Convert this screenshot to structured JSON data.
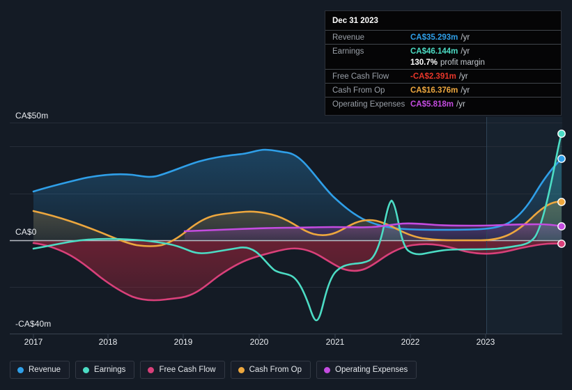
{
  "tooltip": {
    "date": "Dec 31 2023",
    "rows": [
      {
        "label": "Revenue",
        "value": "CA$35.293m",
        "suffix": "/yr",
        "color": "#2f9fe8"
      },
      {
        "label": "Earnings",
        "value": "CA$46.144m",
        "suffix": "/yr",
        "color": "#4cdcc4"
      },
      {
        "label": "",
        "value": "130.7%",
        "suffix": "profit margin",
        "color": "#ffffff"
      },
      {
        "label": "Free Cash Flow",
        "value": "-CA$2.391m",
        "suffix": "/yr",
        "color": "#e8362a"
      },
      {
        "label": "Cash From Op",
        "value": "CA$16.376m",
        "suffix": "/yr",
        "color": "#eda73e"
      },
      {
        "label": "Operating Expenses",
        "value": "CA$5.818m",
        "suffix": "/yr",
        "color": "#c44ce0"
      }
    ]
  },
  "axes": {
    "y_top": "CA$50m",
    "y_zero": "CA$0",
    "y_bottom": "-CA$40m",
    "x_labels": [
      "2017",
      "2018",
      "2019",
      "2020",
      "2021",
      "2022",
      "2023"
    ]
  },
  "legend": [
    {
      "label": "Revenue",
      "color": "#2f9fe8"
    },
    {
      "label": "Earnings",
      "color": "#4cdcc4"
    },
    {
      "label": "Free Cash Flow",
      "color": "#d9407a"
    },
    {
      "label": "Cash From Op",
      "color": "#eda73e"
    },
    {
      "label": "Operating Expenses",
      "color": "#c44ce0"
    }
  ],
  "chart_data": {
    "type": "area",
    "title": "",
    "xlabel": "",
    "ylabel": "CA$",
    "ylim": [
      -40,
      50
    ],
    "xlim": [
      2016.75,
      2024.0
    ],
    "grid": true,
    "legend_position": "bottom",
    "currency": "CA$",
    "units": "millions",
    "gridline_values": [
      50,
      42,
      26,
      10,
      -6,
      -22,
      -40
    ],
    "forecast_start": 2022.85,
    "annotation": "Vertical divider at 2022.85 separates historical from forecast period; forecast region has lighter background.",
    "x": [
      2016.85,
      2017.1,
      2017.35,
      2017.6,
      2017.85,
      2018.1,
      2018.35,
      2018.6,
      2018.85,
      2019.1,
      2019.35,
      2019.6,
      2019.85,
      2020.1,
      2020.35,
      2020.6,
      2020.85,
      2021.1,
      2021.35,
      2021.6,
      2021.85,
      2022.1,
      2022.35,
      2022.6,
      2022.85,
      2023.1,
      2023.35,
      2023.6,
      2023.85
    ],
    "series": [
      {
        "name": "Revenue",
        "color": "#2f9fe8",
        "values": [
          16.5,
          18.5,
          20.0,
          21.5,
          22.5,
          22.0,
          23.5,
          25.5,
          27.5,
          29.5,
          33.0,
          35.5,
          36.0,
          35.0,
          31.0,
          27.5,
          25.0,
          23.0,
          21.0,
          19.0,
          17.5,
          17.0,
          17.0,
          17.0,
          17.0,
          18.0,
          22.0,
          30.0,
          35.293
        ],
        "endpoint_value": 35.293
      },
      {
        "name": "Earnings",
        "color": "#4cdcc4",
        "values": [
          -3.5,
          -2.5,
          -1.5,
          -0.8,
          -0.5,
          -1.0,
          -2.0,
          -2.5,
          -2.5,
          -2.5,
          -3.5,
          -6.0,
          -4.5,
          -8.0,
          -12.0,
          -19.0,
          -30.5,
          -19.0,
          -11.5,
          6.5,
          -9.0,
          -7.5,
          -6.0,
          -5.5,
          -7.5,
          -7.5,
          -6.0,
          12.0,
          46.144
        ],
        "endpoint_value": 46.144
      },
      {
        "name": "Free Cash Flow",
        "color": "#d9407a",
        "values": [
          -1.5,
          -2.0,
          -3.0,
          -5.5,
          -9.5,
          -15.0,
          -20.0,
          -21.5,
          -21.0,
          -15.0,
          -10.0,
          -7.0,
          -5.5,
          -3.0,
          -1.5,
          -3.0,
          -6.0,
          -7.5,
          -6.0,
          -2.5,
          1.0,
          -1.5,
          -4.0,
          -5.5,
          -5.0,
          -4.0,
          -2.0,
          -1.5,
          -2.391
        ],
        "endpoint_value": -2.391
      },
      {
        "name": "Cash From Op",
        "color": "#eda73e",
        "values": [
          10.5,
          9.5,
          8.0,
          6.5,
          4.5,
          2.0,
          -0.5,
          -2.0,
          -2.0,
          0.5,
          4.0,
          6.5,
          7.5,
          8.0,
          7.5,
          6.0,
          4.5,
          3.0,
          4.5,
          5.5,
          3.5,
          1.5,
          0.0,
          -1.0,
          -0.5,
          1.5,
          5.5,
          11.0,
          16.376
        ],
        "endpoint_value": 16.376
      },
      {
        "name": "Operating Expenses",
        "color": "#c44ce0",
        "start_x": 2018.85,
        "values": [
          null,
          null,
          null,
          null,
          null,
          null,
          null,
          null,
          3.2,
          3.4,
          3.6,
          3.8,
          4.0,
          4.2,
          4.3,
          4.4,
          4.5,
          4.4,
          4.6,
          5.0,
          4.6,
          4.4,
          4.4,
          4.6,
          4.8,
          5.0,
          5.2,
          5.5,
          5.818
        ],
        "endpoint_value": 5.818
      }
    ]
  }
}
